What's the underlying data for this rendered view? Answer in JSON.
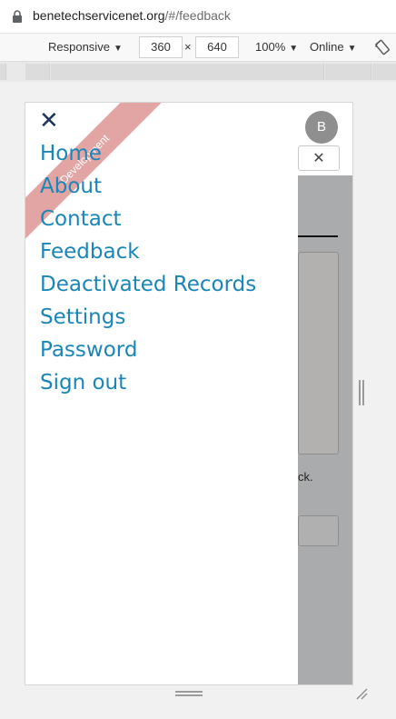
{
  "browser": {
    "url_host": "benetechservicenet.org",
    "url_path": "/#/feedback"
  },
  "devtools": {
    "device": "Responsive",
    "width": "360",
    "times": "×",
    "height": "640",
    "zoom": "100%",
    "network": "Online"
  },
  "page": {
    "avatar_initial": "B",
    "close_glyph": "✕",
    "partial_text": "ck."
  },
  "drawer": {
    "close_glyph": "✕",
    "ribbon_label": "Development",
    "menu": [
      "Home",
      "About",
      "Contact",
      "Feedback",
      "Deactivated Records",
      "Settings",
      "Password",
      "Sign out"
    ]
  },
  "icons": {
    "lock": "lock-icon",
    "rotate": "rotate-icon",
    "close": "close-icon"
  },
  "colors": {
    "menu_link": "#1a86b8",
    "ribbon": "#e3a4a4",
    "overlay": "#a9abad",
    "close_icon": "#1d3557"
  }
}
